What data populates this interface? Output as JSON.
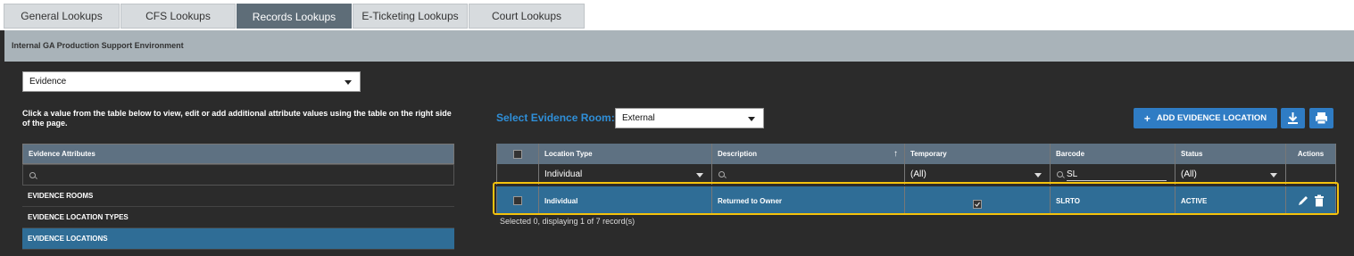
{
  "tabs": [
    "General Lookups",
    "CFS Lookups",
    "Records Lookups",
    "E-Ticketing Lookups",
    "Court Lookups"
  ],
  "environment": "Internal GA Production Support Environment",
  "lookup_select": "Evidence",
  "help_text": "Click a value from the table below to view, edit or add additional attribute values using the table on the right side of the page.",
  "left_table": {
    "header": "Evidence Attributes",
    "items": [
      "EVIDENCE ROOMS",
      "EVIDENCE LOCATION TYPES",
      "EVIDENCE LOCATIONS"
    ]
  },
  "room": {
    "label": "Select Evidence Room:",
    "value": "External"
  },
  "buttons": {
    "add": "ADD EVIDENCE LOCATION",
    "download_icon": "download-icon",
    "print_icon": "print-icon"
  },
  "grid": {
    "columns": [
      "Location Type",
      "Description",
      "Temporary",
      "Barcode",
      "Status",
      "Actions"
    ],
    "sort_indicator": "↑",
    "filters": {
      "location_type": "Individual",
      "temporary": "(All)",
      "barcode": "SL",
      "status": "(All)"
    },
    "rows": [
      {
        "location_type": "Individual",
        "description": "Returned to Owner",
        "temporary": true,
        "barcode": "SLRTO",
        "status": "ACTIVE"
      }
    ]
  },
  "footer": "Selected 0, displaying 1 of 7 record(s)",
  "colors": {
    "accent": "#2f8fd8",
    "selected_row": "#2f6d96",
    "highlight": "#f4c20d",
    "header": "#5e7182"
  }
}
